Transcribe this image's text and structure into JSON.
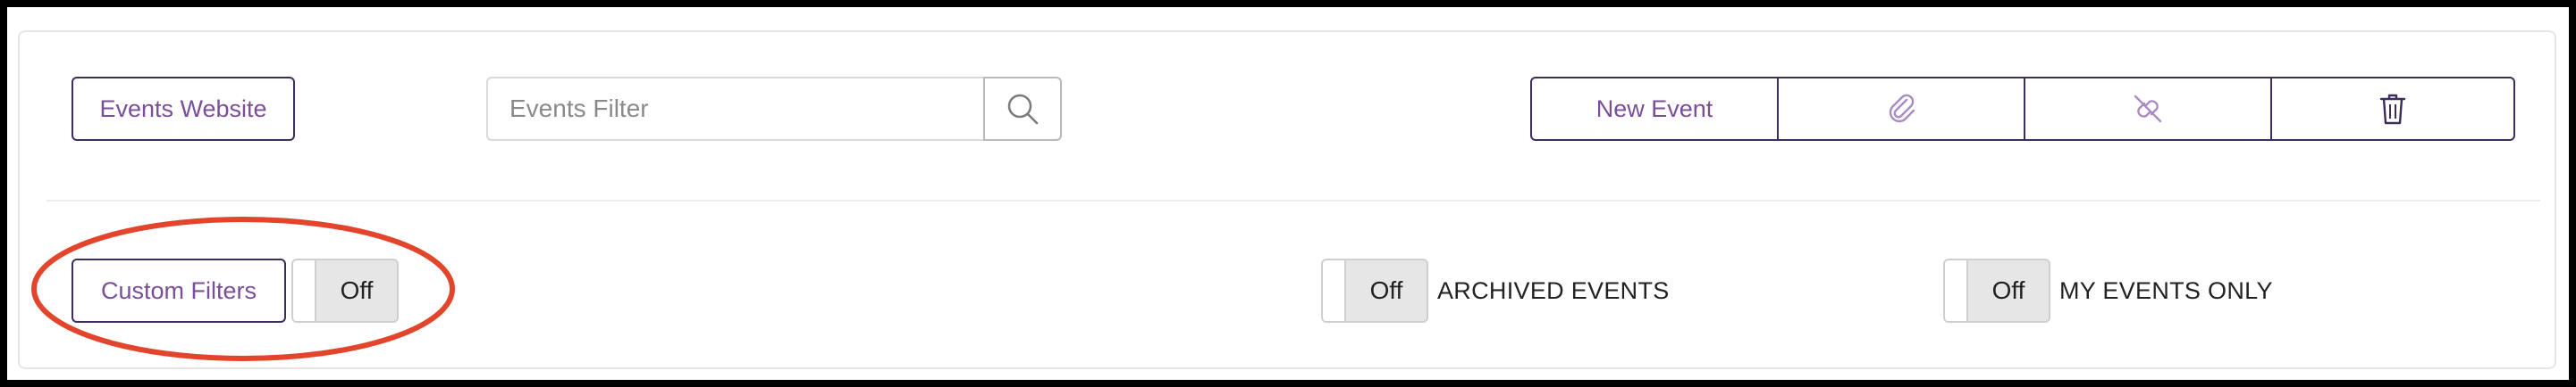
{
  "toolbar": {
    "website_button": "Events Website",
    "search": {
      "placeholder": "Events Filter",
      "value": "",
      "icon": "search-icon"
    },
    "actions": [
      {
        "label": "New Event",
        "icon": ""
      },
      {
        "label": "",
        "icon": "paperclip-icon"
      },
      {
        "label": "",
        "icon": "unlink-icon"
      },
      {
        "label": "",
        "icon": "trash-icon"
      }
    ]
  },
  "filters": {
    "custom_filters_button": "Custom Filters",
    "custom_filters_toggle": "Off",
    "archived": {
      "toggle": "Off",
      "label": "ARCHIVED EVENTS"
    },
    "my_events": {
      "toggle": "Off",
      "label": "MY EVENTS ONLY"
    }
  },
  "colors": {
    "accent": "#7a4e98",
    "border_dark": "#3d2d5a",
    "annotation_red": "#e2452b"
  }
}
